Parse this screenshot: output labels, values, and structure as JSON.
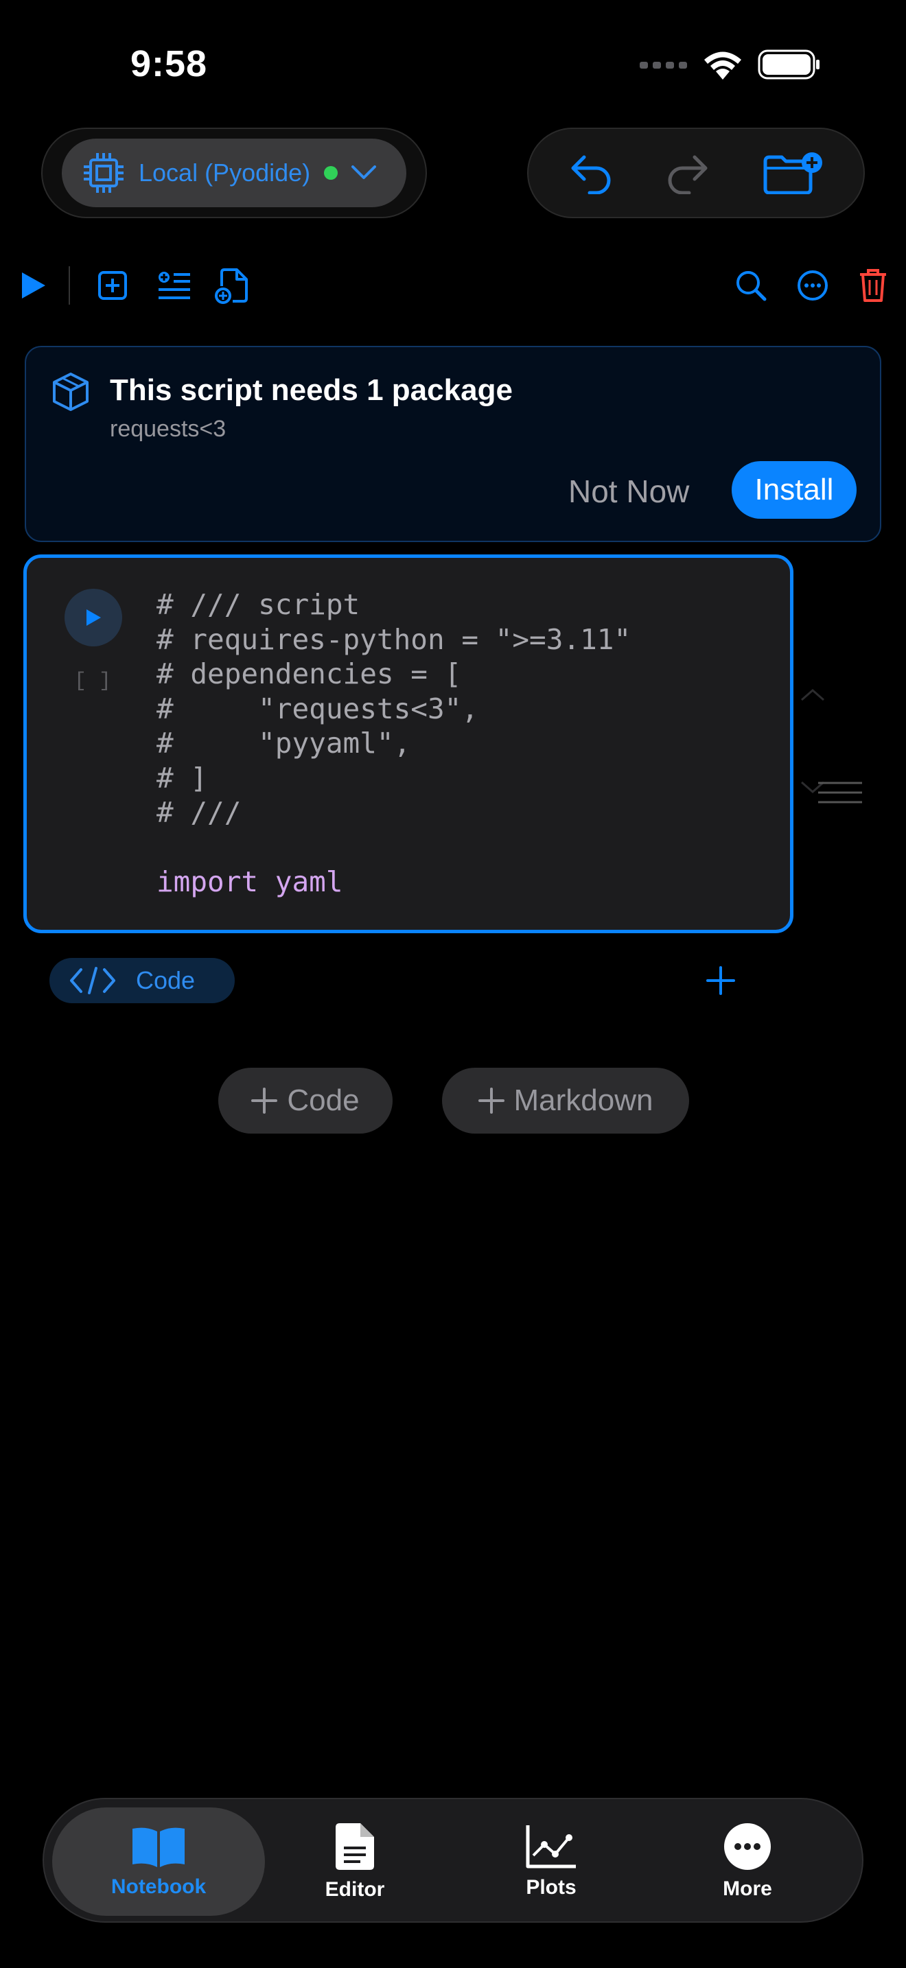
{
  "status_bar": {
    "time": "9:58"
  },
  "runtime": {
    "label": "Local (Pyodide)",
    "status_color": "#30d158"
  },
  "colors": {
    "accent": "#0a84ff",
    "danger": "#ff453a",
    "keyword": "#d4a6f0"
  },
  "banner": {
    "title": "This script needs 1 package",
    "subtitle": "requests<3",
    "not_now_label": "Not Now",
    "install_label": "Install"
  },
  "cell": {
    "execution_count": "[ ]",
    "code_lines": [
      "# /// script",
      "# requires-python = \">=3.11\"",
      "# dependencies = [",
      "#     \"requests<3\",",
      "#     \"pyyaml\",",
      "# ]",
      "# ///",
      "",
      "import yaml"
    ],
    "type_label": "Code"
  },
  "add_buttons": {
    "code_label": "Code",
    "markdown_label": "Markdown"
  },
  "tabs": [
    {
      "label": "Notebook",
      "icon": "book-icon",
      "active": true
    },
    {
      "label": "Editor",
      "icon": "document-icon",
      "active": false
    },
    {
      "label": "Plots",
      "icon": "chart-icon",
      "active": false
    },
    {
      "label": "More",
      "icon": "ellipsis-icon",
      "active": false
    }
  ]
}
